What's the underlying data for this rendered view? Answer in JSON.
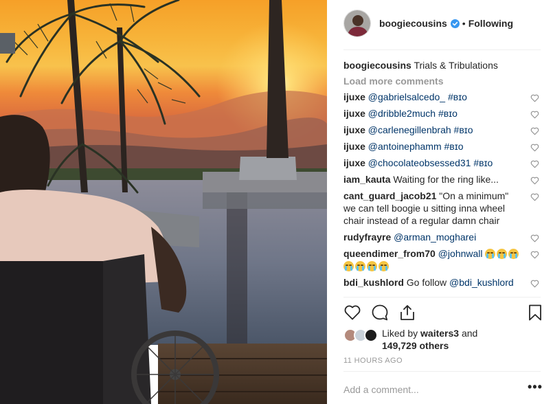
{
  "post": {
    "author": "boogiecousins",
    "follow_state": "Following",
    "separator": "•",
    "caption_user": "boogiecousins",
    "caption_text": "Trials & Tribulations",
    "load_more": "Load more comments"
  },
  "comments": [
    {
      "user": "ijuxe",
      "parts": [
        {
          "text": "@gabrielsalcedo_",
          "tag": true
        },
        {
          "text": " #ʙɪᴏ",
          "tag": true
        }
      ]
    },
    {
      "user": "ijuxe",
      "parts": [
        {
          "text": "@dribble2much",
          "tag": true
        },
        {
          "text": " #ʙɪᴏ",
          "tag": true
        }
      ]
    },
    {
      "user": "ijuxe",
      "parts": [
        {
          "text": "@carlenegillenbrah",
          "tag": true
        },
        {
          "text": " #ʙɪᴏ",
          "tag": true
        }
      ]
    },
    {
      "user": "ijuxe",
      "parts": [
        {
          "text": "@antoinephamm",
          "tag": true
        },
        {
          "text": " #ʙɪᴏ",
          "tag": true
        }
      ]
    },
    {
      "user": "ijuxe",
      "parts": [
        {
          "text": "@chocolateobsessed31",
          "tag": true
        },
        {
          "text": " #ʙɪᴏ",
          "tag": true
        }
      ]
    },
    {
      "user": "iam_kauta",
      "parts": [
        {
          "text": "Waiting for the ring like...",
          "tag": false
        }
      ]
    },
    {
      "user": "cant_guard_jacob21",
      "parts": [
        {
          "text": "\"On a minimum\" we can tell boogie u sitting inna wheel chair instead of a regular damn chair",
          "tag": false
        }
      ]
    },
    {
      "user": "rudyfrayre",
      "parts": [
        {
          "text": "@arman_mogharei",
          "tag": true
        }
      ]
    },
    {
      "user": "queendimer_from70",
      "parts": [
        {
          "text": "@johnwall",
          "tag": true
        }
      ],
      "emoji_count": 7
    },
    {
      "user": "bdi_kushlord",
      "parts": [
        {
          "text": "Go follow ",
          "tag": false
        },
        {
          "text": "@bdi_kushlord",
          "tag": true
        }
      ]
    }
  ],
  "likes": {
    "prefix": "Liked by",
    "liker": "waiters3",
    "middle": "and",
    "others": "149,729 others"
  },
  "timestamp": "11 HOURS AGO",
  "comment_box": {
    "placeholder": "Add a comment..."
  },
  "more_label": "•••",
  "icons": {
    "verified": "verified-badge-icon",
    "heart": "heart-icon",
    "comment": "comment-icon",
    "share": "share-icon",
    "save": "bookmark-icon",
    "more": "more-options-icon"
  },
  "colors": {
    "link": "#003569",
    "muted": "#999999",
    "verified": "#3897f0",
    "divider": "#efefef"
  }
}
